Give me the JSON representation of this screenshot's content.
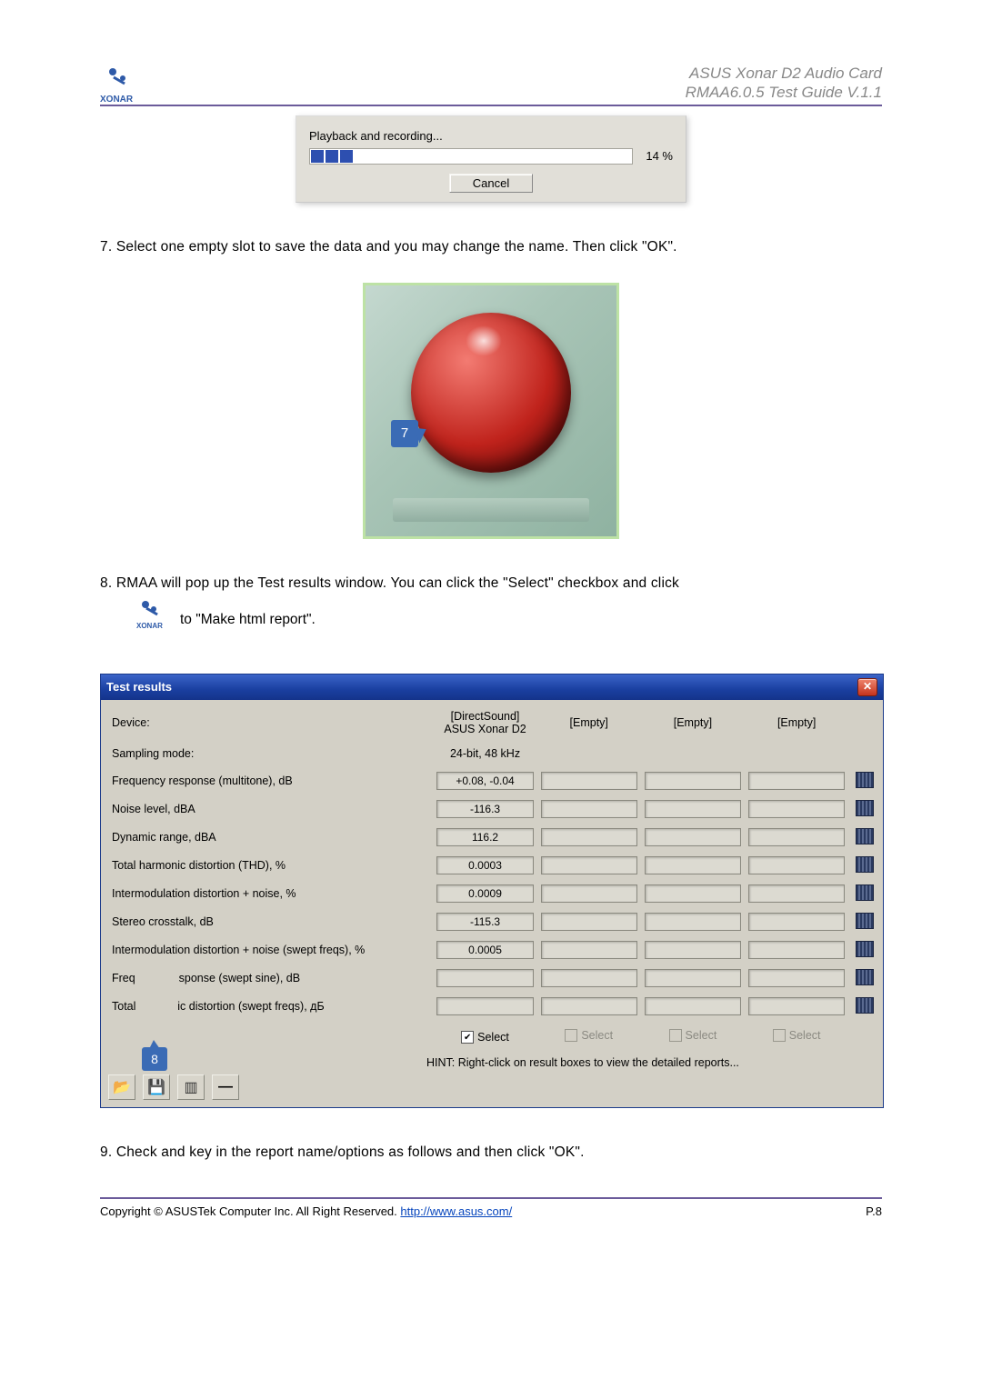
{
  "header": {
    "logo_text": "XONAR",
    "line1": "ASUS Xonar D2 Audio Card",
    "line2": "RMAA6.0.5 Test Guide V.1.1"
  },
  "progress": {
    "label": "Playback and recording...",
    "percent": "14 %",
    "cancel": "Cancel"
  },
  "step7": "7. Select one empty slot to save the data and you may change the name. Then click \"OK\".",
  "callout7": "7",
  "step8a": "8. RMAA will pop up the Test results window. You can click the \"Select\" checkbox and click",
  "step8b": " to \"Make html report\".",
  "inline_logo": "XONAR",
  "tr": {
    "title": "Test results",
    "row_device": "Device:",
    "dev_val1": "[DirectSound]",
    "dev_val1b": "ASUS Xonar D2",
    "dev_empty": "[Empty]",
    "row_sampling": "Sampling mode:",
    "sampling_val": "24-bit, 48 kHz",
    "rows": [
      {
        "label": "Frequency response (multitone), dB",
        "val": "+0.08, -0.04"
      },
      {
        "label": "Noise level, dBA",
        "val": "-116.3"
      },
      {
        "label": "Dynamic range, dBA",
        "val": "116.2"
      },
      {
        "label": "Total harmonic distortion (THD), %",
        "val": "0.0003"
      },
      {
        "label": "Intermodulation distortion + noise, %",
        "val": "0.0009"
      },
      {
        "label": "Stereo crosstalk, dB",
        "val": "-115.3"
      },
      {
        "label": "Intermodulation distortion + noise (swept freqs), %",
        "val": "0.0005"
      }
    ],
    "row_freq_swept_pre": "Freq",
    "row_freq_swept_post": "sponse (swept sine), dB",
    "row_total_swept_pre": "Total",
    "row_total_swept_post": "ic distortion (swept freqs), дБ",
    "select": "Select",
    "hint": "HINT: Right-click on result boxes to view the detailed reports...",
    "callout8": "8"
  },
  "step9": "9. Check and key in the report name/options as follows and then click \"OK\".",
  "footer": {
    "copyright": "Copyright © ASUSTek Computer Inc. All Right Reserved. ",
    "link": "http://www.asus.com/",
    "page": "P.8"
  }
}
